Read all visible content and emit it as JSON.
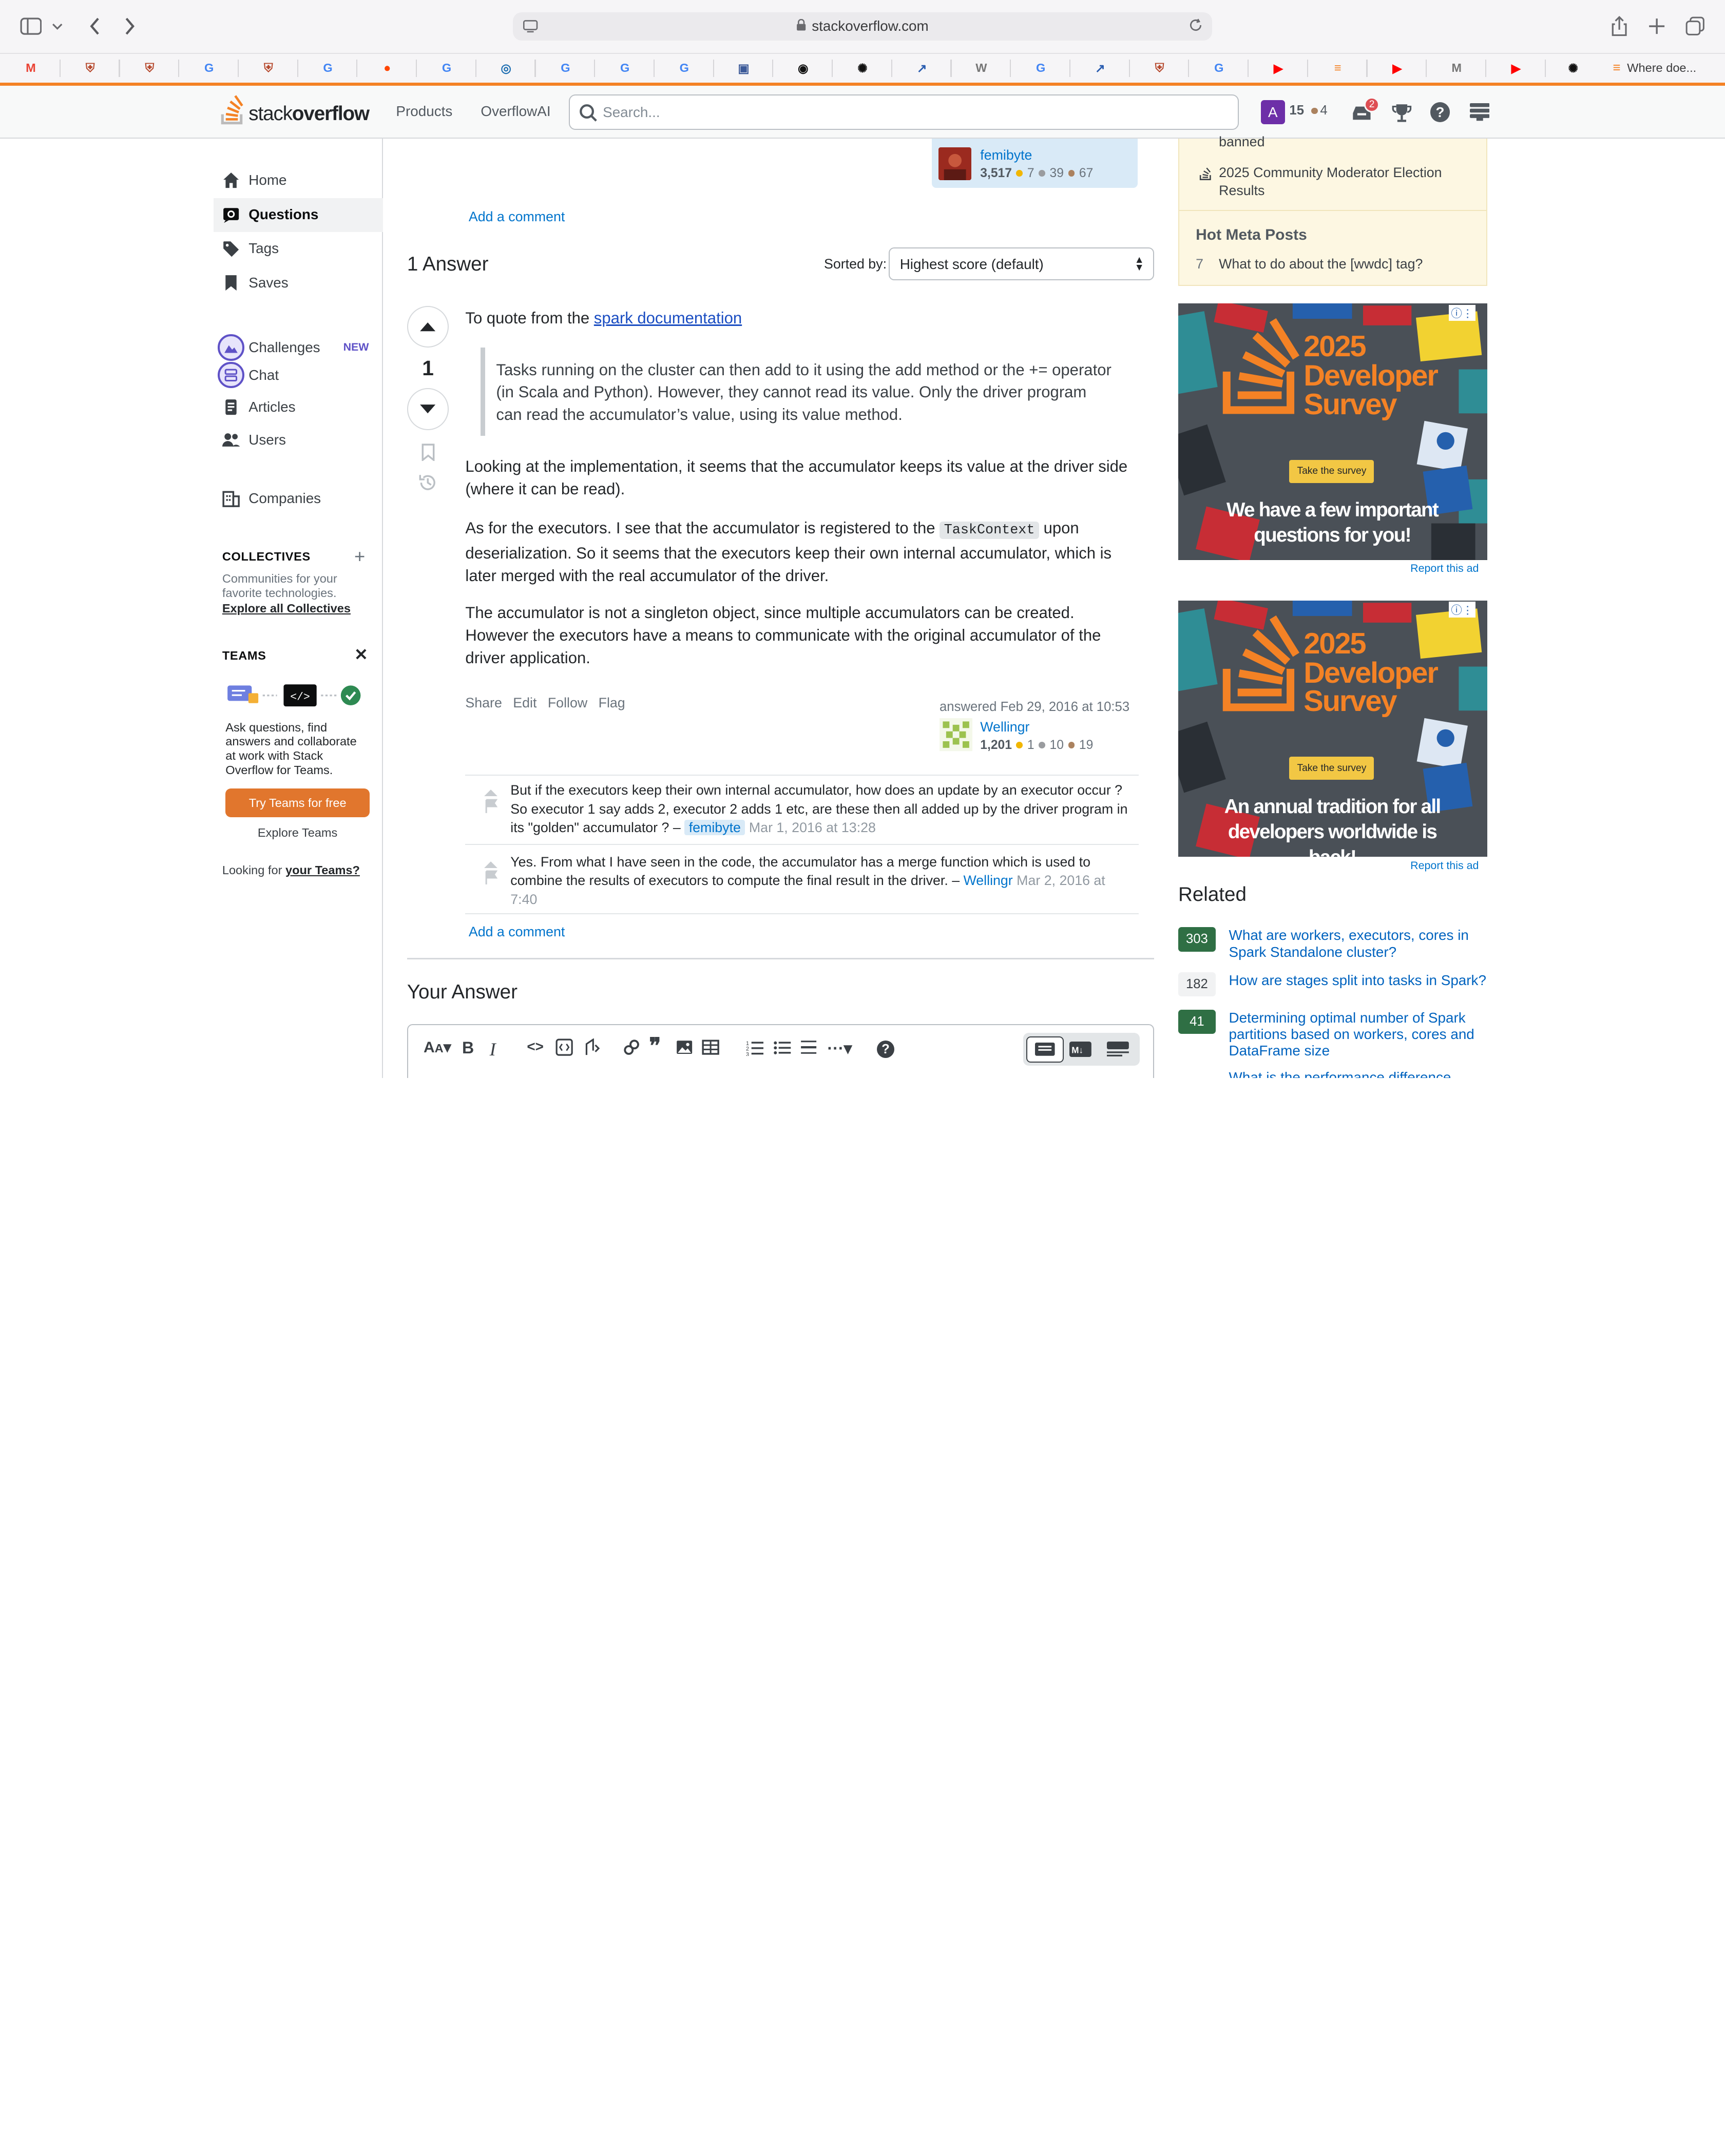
{
  "browser": {
    "url": "stackoverflow.com",
    "tab_title": "Where doe..."
  },
  "bookmarks": [
    {
      "icon": "gmail-icon",
      "glyph": "M",
      "color": "#ea4335"
    },
    {
      "icon": "shield-icon",
      "glyph": "⛨",
      "color": "#b5472b"
    },
    {
      "icon": "shield-icon",
      "glyph": "⛨",
      "color": "#b5472b"
    },
    {
      "icon": "google-icon",
      "glyph": "G",
      "color": "#4285f4"
    },
    {
      "icon": "shield-icon",
      "glyph": "⛨",
      "color": "#b5472b"
    },
    {
      "icon": "google-icon",
      "glyph": "G",
      "color": "#4285f4"
    },
    {
      "icon": "reddit-icon",
      "glyph": "●",
      "color": "#ff4500"
    },
    {
      "icon": "google-icon",
      "glyph": "G",
      "color": "#4285f4"
    },
    {
      "icon": "link-icon",
      "glyph": "◎",
      "color": "#1f6fb2"
    },
    {
      "icon": "google-icon",
      "glyph": "G",
      "color": "#4285f4"
    },
    {
      "icon": "google-icon",
      "glyph": "G",
      "color": "#4285f4"
    },
    {
      "icon": "google-icon",
      "glyph": "G",
      "color": "#4285f4"
    },
    {
      "icon": "image-icon",
      "glyph": "▣",
      "color": "#3b5998"
    },
    {
      "icon": "github-icon",
      "glyph": "◉",
      "color": "#111111"
    },
    {
      "icon": "openai-icon",
      "glyph": "✺",
      "color": "#111111"
    },
    {
      "icon": "trend-icon",
      "glyph": "↗",
      "color": "#2a5db0"
    },
    {
      "icon": "wiki-icon",
      "glyph": "W",
      "color": "#777777"
    },
    {
      "icon": "google-icon",
      "glyph": "G",
      "color": "#4285f4"
    },
    {
      "icon": "trend-icon",
      "glyph": "↗",
      "color": "#2a5db0"
    },
    {
      "icon": "shield-icon",
      "glyph": "⛨",
      "color": "#b5472b"
    },
    {
      "icon": "google-icon",
      "glyph": "G",
      "color": "#4285f4"
    },
    {
      "icon": "youtube-icon",
      "glyph": "▶",
      "color": "#ff0000"
    },
    {
      "icon": "stackoverflow-icon",
      "glyph": "≡",
      "color": "#f48225"
    },
    {
      "icon": "youtube-icon",
      "glyph": "▶",
      "color": "#ff0000"
    },
    {
      "icon": "medium-icon",
      "glyph": "M",
      "color": "#777777"
    },
    {
      "icon": "youtube-icon",
      "glyph": "▶",
      "color": "#ff0000"
    },
    {
      "icon": "openai-icon",
      "glyph": "✺",
      "color": "#111111"
    }
  ],
  "header": {
    "logo_stack": "stack",
    "logo_overflow": "overflow",
    "products": "Products",
    "overflowai": "OverflowAI",
    "search_placeholder": "Search...",
    "avatar_letter": "A",
    "reputation": "15",
    "bronze": "4",
    "inbox_count": "2"
  },
  "left_nav": {
    "home": "Home",
    "questions": "Questions",
    "tags": "Tags",
    "saves": "Saves",
    "challenges": "Challenges",
    "challenges_badge": "NEW",
    "chat": "Chat",
    "articles": "Articles",
    "users": "Users",
    "companies": "Companies",
    "collectives_title": "COLLECTIVES",
    "collectives_desc": "Communities for your favorite technologies.",
    "collectives_link": "Explore all Collectives",
    "teams_title": "TEAMS",
    "teams_desc": "Ask questions, find answers and collaborate at work with Stack Overflow for Teams.",
    "teams_button": "Try Teams for free",
    "teams_explore": "Explore Teams",
    "teams_looking": "Looking for",
    "teams_your": "your Teams?"
  },
  "question_tail": {
    "asker_name": "femibyte",
    "asker_rep": "3,517",
    "asker_gold": "7",
    "asker_silver": "39",
    "asker_bronze": "67",
    "add_comment": "Add a comment"
  },
  "answers_header": {
    "count": "1 Answer",
    "sorted_label": "Sorted by:",
    "sorted_value": "Highest score (default)"
  },
  "answer": {
    "score": "1",
    "intro": "To quote from the ",
    "intro_link": "spark documentation",
    "quote": "Tasks running on the cluster can then add to it using the add method or the += operator (in Scala and Python). However, they cannot read its value. Only the driver program can read the accumulator’s value, using its value method.",
    "p1": "Looking at the implementation, it seems that the accumulator keeps its value at the driver side (where it can be read).",
    "p2_a": "As for the executors. I see that the accumulator is registered to the ",
    "p2_code": "TaskContext",
    "p2_b": " upon deserialization. So it seems that the executors keep their own internal accumulator, which is later merged with the real accumulator of the driver.",
    "p3": "The accumulator is not a singleton object, since multiple accumulators can be created. However the executors have a means to communicate with the original accumulator of the driver application.",
    "share": "Share",
    "edit": "Edit",
    "follow": "Follow",
    "flag": "Flag",
    "answered": "answered Feb 29, 2016 at 10:53",
    "author": "Wellingr",
    "author_rep": "1,201",
    "author_gold": "1",
    "author_silver": "10",
    "author_bronze": "19"
  },
  "comments": [
    {
      "text": "But if the executors keep their own internal accumulator, how does an update by an executor occur ? So executor 1 say adds 2, executor 2 adds 1 etc, are these then all added up by the driver program in its \"golden\" accumulator ? –",
      "user": "femibyte",
      "date": "Mar 1, 2016 at 13:28"
    },
    {
      "text": "Yes. From what I have seen in the code, the accumulator has a merge function which is used to combine the results of executors to compute the final result in the driver. –",
      "user": "Wellingr",
      "date": "Mar 2, 2016 at 7:40"
    }
  ],
  "answer_add_comment": "Add a comment",
  "your_answer": "Your Answer",
  "sidebar": {
    "item_banned": "banned",
    "item_election": "2025 Community Moderator Election Results",
    "hot_meta_title": "Hot Meta Posts",
    "hot_meta_count": "7",
    "hot_meta_item": "What to do about the [wwdc] tag?",
    "ad_year": "2025",
    "ad_title": "Developer Survey",
    "ad_button": "Take the survey",
    "ad1_tagline": "We have a few important questions for you!",
    "ad2_tagline": "An annual tradition for all developers worldwide is back!",
    "report_ad": "Report this ad",
    "related_title": "Related",
    "related": [
      {
        "count": "303",
        "title": "What are workers, executors, cores in Spark Standalone cluster?",
        "answered": true
      },
      {
        "count": "182",
        "title": "How are stages split into tasks in Spark?",
        "answered": false
      },
      {
        "count": "41",
        "title": "Determining optimal number of Spark partitions based on workers, cores and DataFrame size",
        "answered": true
      },
      {
        "count": "",
        "title": "What is the performance difference",
        "answered": false
      }
    ]
  },
  "colors": {
    "accent": "#f48225",
    "link": "#0074cc",
    "answered_green": "#2f6f44"
  }
}
